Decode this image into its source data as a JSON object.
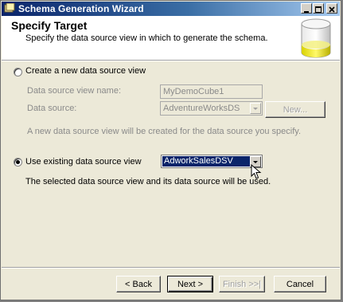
{
  "window": {
    "title": "Schema Generation Wizard"
  },
  "header": {
    "title": "Specify Target",
    "subtitle": "Specify the data source view in which to generate the schema."
  },
  "options": {
    "create_new": {
      "label": "Create a new data source view",
      "selected": false,
      "name_label": "Data source view name:",
      "name_value": "MyDemoCube1",
      "source_label": "Data source:",
      "source_value": "AdventureWorksDS",
      "new_button": "New...",
      "note": "A new data source view will be created for the data source you specify."
    },
    "use_existing": {
      "label": "Use existing data source view",
      "selected": true,
      "dsv_value": "AdworkSalesDSV",
      "note": "The selected data source view and its data source will be used."
    }
  },
  "buttons": {
    "back": "< Back",
    "next": "Next >",
    "finish": "Finish >>|",
    "cancel": "Cancel"
  }
}
